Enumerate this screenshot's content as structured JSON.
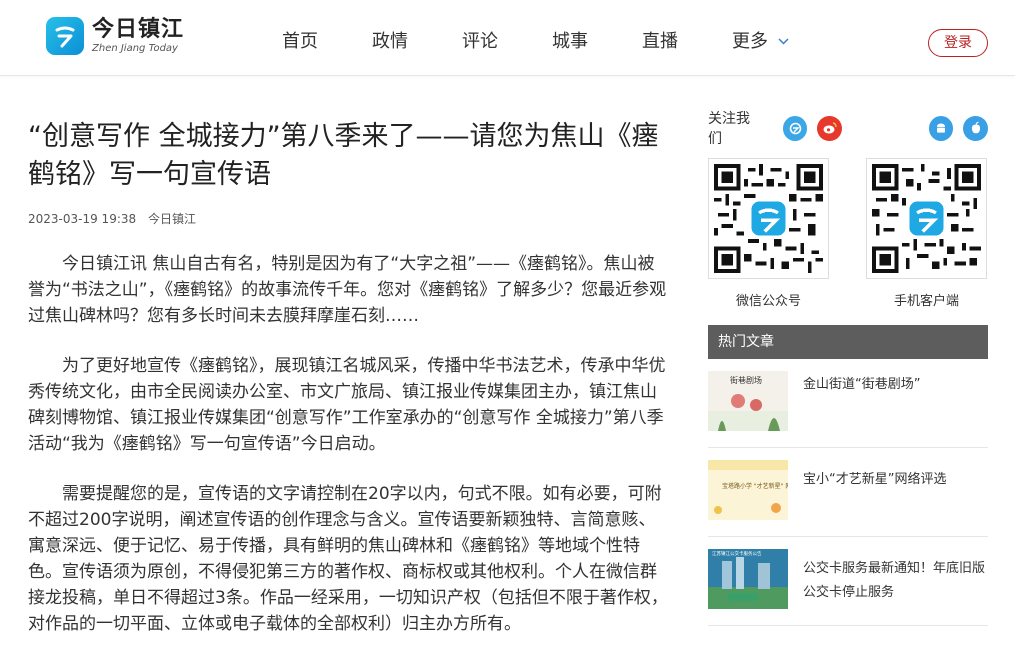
{
  "site": {
    "logo_cn": "今日镇江",
    "logo_en": "Zhen Jiang Today"
  },
  "nav": {
    "items": [
      "首页",
      "政情",
      "评论",
      "城事",
      "直播"
    ],
    "more": "更多",
    "login": "登录"
  },
  "article": {
    "title": "“创意写作 全城接力”第八季来了——请您为焦山《瘗鹤铭》写一句宣传语",
    "date": "2023-03-19 19:38",
    "source": "今日镇江",
    "paragraphs": [
      "今日镇江讯 焦山自古有名，特别是因为有了“大字之祖”——《瘗鹤铭》。焦山被誉为“书法之山”，《瘗鹤铭》的故事流传千年。您对《瘗鹤铭》了解多少？您最近参观过焦山碑林吗？您有多长时间未去膜拜摩崖石刻……",
      "为了更好地宣传《瘗鹤铭》，展现镇江名城风采，传播中华书法艺术，传承中华优秀传统文化，由市全民阅读办公室、市文广旅局、镇江报业传媒集团主办，镇江焦山碑刻博物馆、镇江报业传媒集团“创意写作”工作室承办的“创意写作 全城接力”第八季活动“我为《瘗鹤铭》写一句宣传语”今日启动。",
      "需要提醒您的是，宣传语的文字请控制在20字以内，句式不限。如有必要，可附不超过200字说明，阐述宣传语的创作理念与含义。宣传语要新颖独特、言简意赅、寓意深远、便于记忆、易于传播，具有鲜明的焦山碑林和《瘗鹤铭》等地域个性特色。宣传语须为原创，不得侵犯第三方的著作权、商标权或其他权利。个人在微信群接龙投稿，单日不得超过3条。作品一经采用，一切知识产权（包括但不限于著作权，对作品的一切平面、立体或电子载体的全部权利）归主办方所有。"
    ]
  },
  "sidebar": {
    "follow_label": "关注我们",
    "qr_left_caption": "微信公众号",
    "qr_right_caption": "手机客户端",
    "hot_header": "热门文章",
    "hot_items": [
      "金山街道“街巷剧场”",
      "宝小“才艺新星”网络评选",
      "公交卡服务最新通知！年底旧版公交卡停止服务"
    ],
    "thumb1_text": "街巷剧场",
    "thumb2_text": "宝塔路小学 \"才艺新星\" 网络评选",
    "thumb3_text": "江苏镇江公交卡服务公告"
  },
  "colors": {
    "accent": "#0b8fd6",
    "login_red": "#b22222",
    "hot_header_bg": "#5d5d5d"
  }
}
